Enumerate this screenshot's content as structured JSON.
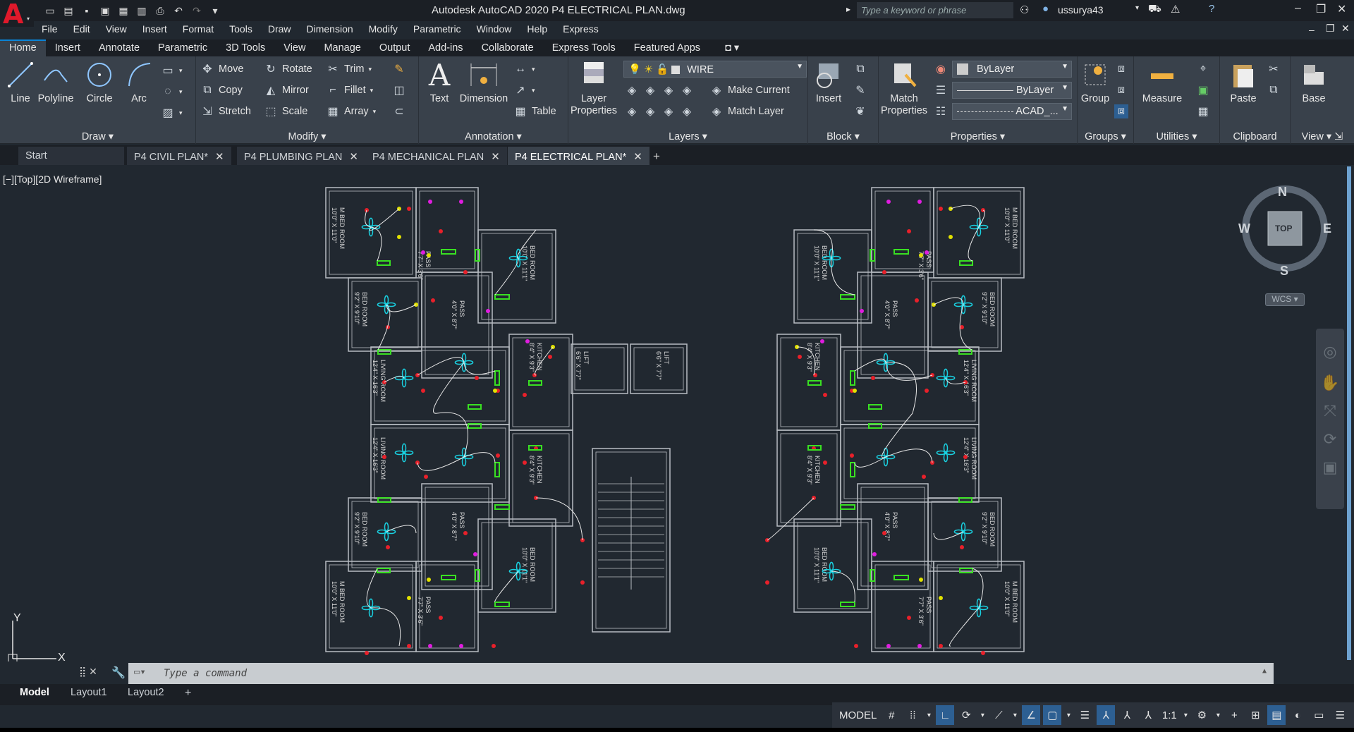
{
  "app": {
    "title": "Autodesk AutoCAD 2020    P4 ELECTRICAL PLAN.dwg",
    "search_placeholder": "Type a keyword or phrase",
    "user": "ussurya43"
  },
  "menu": [
    "File",
    "Edit",
    "View",
    "Insert",
    "Format",
    "Tools",
    "Draw",
    "Dimension",
    "Modify",
    "Parametric",
    "Window",
    "Help",
    "Express"
  ],
  "ribbon_tabs": [
    "Home",
    "Insert",
    "Annotate",
    "Parametric",
    "3D Tools",
    "View",
    "Manage",
    "Output",
    "Add-ins",
    "Collaborate",
    "Express Tools",
    "Featured Apps"
  ],
  "ribbon_active_tab": "Home",
  "panels": {
    "draw": {
      "label": "Draw",
      "line": "Line",
      "polyline": "Polyline",
      "circle": "Circle",
      "arc": "Arc"
    },
    "modify": {
      "label": "Modify",
      "move": "Move",
      "rotate": "Rotate",
      "trim": "Trim",
      "copy": "Copy",
      "mirror": "Mirror",
      "fillet": "Fillet",
      "stretch": "Stretch",
      "scale": "Scale",
      "array": "Array"
    },
    "annotation": {
      "label": "Annotation",
      "text": "Text",
      "dimension": "Dimension",
      "table": "Table"
    },
    "layers": {
      "label": "Layers",
      "layer_properties": "Layer Properties",
      "current_layer": "WIRE",
      "make_current": "Make Current",
      "match_layer": "Match Layer"
    },
    "block": {
      "label": "Block",
      "insert": "Insert"
    },
    "properties": {
      "label": "Properties",
      "match_properties": "Match Properties",
      "color": "ByLayer",
      "lineweight": "ByLayer",
      "linetype": "ACAD_..."
    },
    "groups": {
      "label": "Groups",
      "group": "Group"
    },
    "utilities": {
      "label": "Utilities",
      "measure": "Measure"
    },
    "clipboard": {
      "label": "Clipboard",
      "paste": "Paste"
    },
    "view": {
      "label": "View",
      "base": "Base"
    }
  },
  "file_tabs": [
    {
      "label": "Start"
    },
    {
      "label": "P4 CIVIL PLAN*"
    },
    {
      "label": "P4 PLUMBING PLAN"
    },
    {
      "label": "P4 MECHANICAL PLAN"
    },
    {
      "label": "P4 ELECTRICAL PLAN*"
    }
  ],
  "viewport_label": "[−][Top][2D Wireframe]",
  "viewcube": {
    "n": "N",
    "s": "S",
    "e": "E",
    "w": "W",
    "top": "TOP",
    "wcs": "WCS"
  },
  "ucs": {
    "x": "X",
    "y": "Y"
  },
  "command_placeholder": "Type a command",
  "layout_tabs": [
    "Model",
    "Layout1",
    "Layout2"
  ],
  "status": {
    "model": "MODEL",
    "scale": "1:1"
  },
  "room_labels": {
    "mbed": "M BED ROOM\n10'0\" X 11'0\"",
    "bed": "BED ROOM\n10'0\" X 11'1\"",
    "bed2": "BED ROOM\n9'2\" X 9'10\"",
    "pass1": "PASS\n7'7\" X 3'6\"",
    "pass2": "PASS\n4'0\" X 8'7\"",
    "living": "LIVING ROOM\n12'4\" X 16'3\"",
    "kitchen": "KITCHEN\n8'4\" X 9'3\"",
    "lift": "LIFT\n6'6\" X 7'7\""
  },
  "colors": {
    "wall": "#b8bcc2",
    "fan": "#19d0e0",
    "wire": "#e8e8e8",
    "switch": "#39e022",
    "socket": "#e1e100",
    "point": "#e01ce0",
    "light": "#e8202a"
  }
}
